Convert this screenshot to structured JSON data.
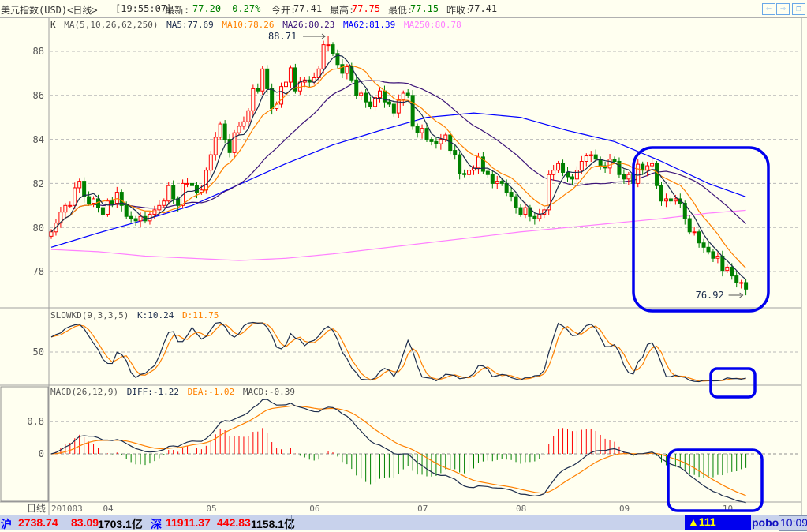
{
  "title": {
    "instrument": "美元指数(USD)<日线>",
    "time": "[19:55:07]",
    "last_label": "最新:",
    "last": "77.20",
    "change_pct": "-0.27%",
    "open_label": "今开:",
    "open": "77.41",
    "high_label": "最高:",
    "high": "77.75",
    "low_label": "最低:",
    "low": "77.15",
    "prev_close_label": "昨收:",
    "prev_close": "77.41",
    "nav_icons": [
      "arrow-left-icon",
      "arrow-right-icon",
      "restore-window-icon"
    ]
  },
  "main_legend": {
    "k": "K",
    "ma_params": "MA(5,10,26,62,250)",
    "ma5": "MA5:77.69",
    "ma10": "MA10:78.26",
    "ma26": "MA26:80.23",
    "ma62": "MA62:81.39",
    "ma250": "MA250:80.78"
  },
  "kd_legend": {
    "name": "SLOWKD(9,3,3,5)",
    "k": "K:10.24",
    "d": "D:11.75"
  },
  "macd_legend": {
    "name": "MACD(26,12,9)",
    "diff": "DIFF:-1.22",
    "dea": "DEA:-1.02",
    "macd": "MACD:-0.39"
  },
  "colors": {
    "background": "#fffff0",
    "up": "#ff0000",
    "down": "#008000",
    "ma5": "#1c2c4c",
    "ma10": "#ff8000",
    "ma26": "#3c1478",
    "ma62": "#0000ff",
    "ma250": "#ff80ff",
    "k": "#1c2c4c",
    "d": "#ff8000",
    "annotation": "#0000ee"
  },
  "chart_data": [
    {
      "type": "candlestick",
      "yticks": [
        "88",
        "86",
        "84",
        "82",
        "80",
        "78"
      ],
      "ylim": [
        76.6,
        88.9
      ],
      "high_marker": "88.71",
      "low_marker": "76.92",
      "closes": [
        79.8,
        80.2,
        80.7,
        81.0,
        81.0,
        81.8,
        82.1,
        81.4,
        81.1,
        81.3,
        80.9,
        80.6,
        81.2,
        81.1,
        81.6,
        81.0,
        80.5,
        80.4,
        80.3,
        80.5,
        80.3,
        80.6,
        80.8,
        81.0,
        81.2,
        81.9,
        81.3,
        81.0,
        82.0,
        82.0,
        81.9,
        81.6,
        81.7,
        82.6,
        83.3,
        84.1,
        84.7,
        84.0,
        83.4,
        84.3,
        84.6,
        84.8,
        85.3,
        86.3,
        86.2,
        87.2,
        86.3,
        85.4,
        85.6,
        86.4,
        86.6,
        87.25,
        86.2,
        86.6,
        86.7,
        86.6,
        86.8,
        87.2,
        88.3,
        88.3,
        87.9,
        87.4,
        87.0,
        87.3,
        86.7,
        86.0,
        86.1,
        85.7,
        85.5,
        85.9,
        86.2,
        85.7,
        85.6,
        85.2,
        85.8,
        86.1,
        86.0,
        84.6,
        84.3,
        84.5,
        84.0,
        83.9,
        83.8,
        84.0,
        84.2,
        83.5,
        83.3,
        82.45,
        82.4,
        82.6,
        82.7,
        83.2,
        82.55,
        82.4,
        82.0,
        82.1,
        82.0,
        81.6,
        81.4,
        80.9,
        80.6,
        80.9,
        80.5,
        80.4,
        80.6,
        80.8,
        82.4,
        82.6,
        82.9,
        82.5,
        82.3,
        82.2,
        82.6,
        83.0,
        83.25,
        83.3,
        83.1,
        82.8,
        82.7,
        83.1,
        83.0,
        82.4,
        82.2,
        82.4,
        82.0,
        82.87,
        82.6,
        82.8,
        82.9,
        81.9,
        81.2,
        81.3,
        81.2,
        81.3,
        81.1,
        80.4,
        79.8,
        79.8,
        79.3,
        79.1,
        78.9,
        78.6,
        78.7,
        78.05,
        78.2,
        77.8,
        77.5,
        77.5,
        77.2
      ],
      "ma62": [
        [
          0,
          79.1
        ],
        [
          10,
          79.75
        ],
        [
          20,
          80.35
        ],
        [
          30,
          81.0
        ],
        [
          40,
          81.95
        ],
        [
          50,
          82.9
        ],
        [
          60,
          83.75
        ],
        [
          70,
          84.4
        ],
        [
          80,
          85.0
        ],
        [
          90,
          85.2
        ],
        [
          100,
          85.0
        ],
        [
          110,
          84.4
        ],
        [
          120,
          83.9
        ],
        [
          130,
          83.0
        ],
        [
          140,
          82.0
        ],
        [
          148,
          81.39
        ]
      ],
      "ma250": [
        [
          0,
          79.0
        ],
        [
          10,
          78.9
        ],
        [
          20,
          78.7
        ],
        [
          30,
          78.6
        ],
        [
          40,
          78.5
        ],
        [
          50,
          78.6
        ],
        [
          60,
          78.8
        ],
        [
          70,
          79.05
        ],
        [
          80,
          79.3
        ],
        [
          90,
          79.55
        ],
        [
          100,
          79.8
        ],
        [
          110,
          80.0
        ],
        [
          120,
          80.2
        ],
        [
          130,
          80.4
        ],
        [
          140,
          80.65
        ],
        [
          148,
          80.78
        ]
      ],
      "xticks": [
        {
          "label": "201003",
          "index": 0
        },
        {
          "label": "04",
          "index": 11
        },
        {
          "label": "05",
          "index": 33
        },
        {
          "label": "06",
          "index": 55
        },
        {
          "label": "07",
          "index": 78
        },
        {
          "label": "08",
          "index": 99
        },
        {
          "label": "09",
          "index": 121
        },
        {
          "label": "10",
          "index": 143
        }
      ]
    },
    {
      "type": "line",
      "title": "SLOWKD(9,3,3,5)",
      "yticks": [
        "50"
      ],
      "ylim": [
        0,
        100
      ]
    },
    {
      "type": "bar",
      "title": "MACD(26,12,9)",
      "yticks": [
        "0.8",
        "0"
      ],
      "ylim": [
        -1.3,
        1.1
      ]
    }
  ],
  "axis": {
    "period_label": "日线"
  },
  "status_bar": {
    "sh_label": "沪",
    "sh_index": "2738.74",
    "sh_change": "83.09",
    "sh_volume": "1703.1亿",
    "sz_label": "深",
    "sz_index": "11911.37",
    "sz_change": "442.83",
    "sz_volume": "1158.1亿",
    "alerts": "▲111",
    "brand": "pobo",
    "clock": "10:09"
  }
}
